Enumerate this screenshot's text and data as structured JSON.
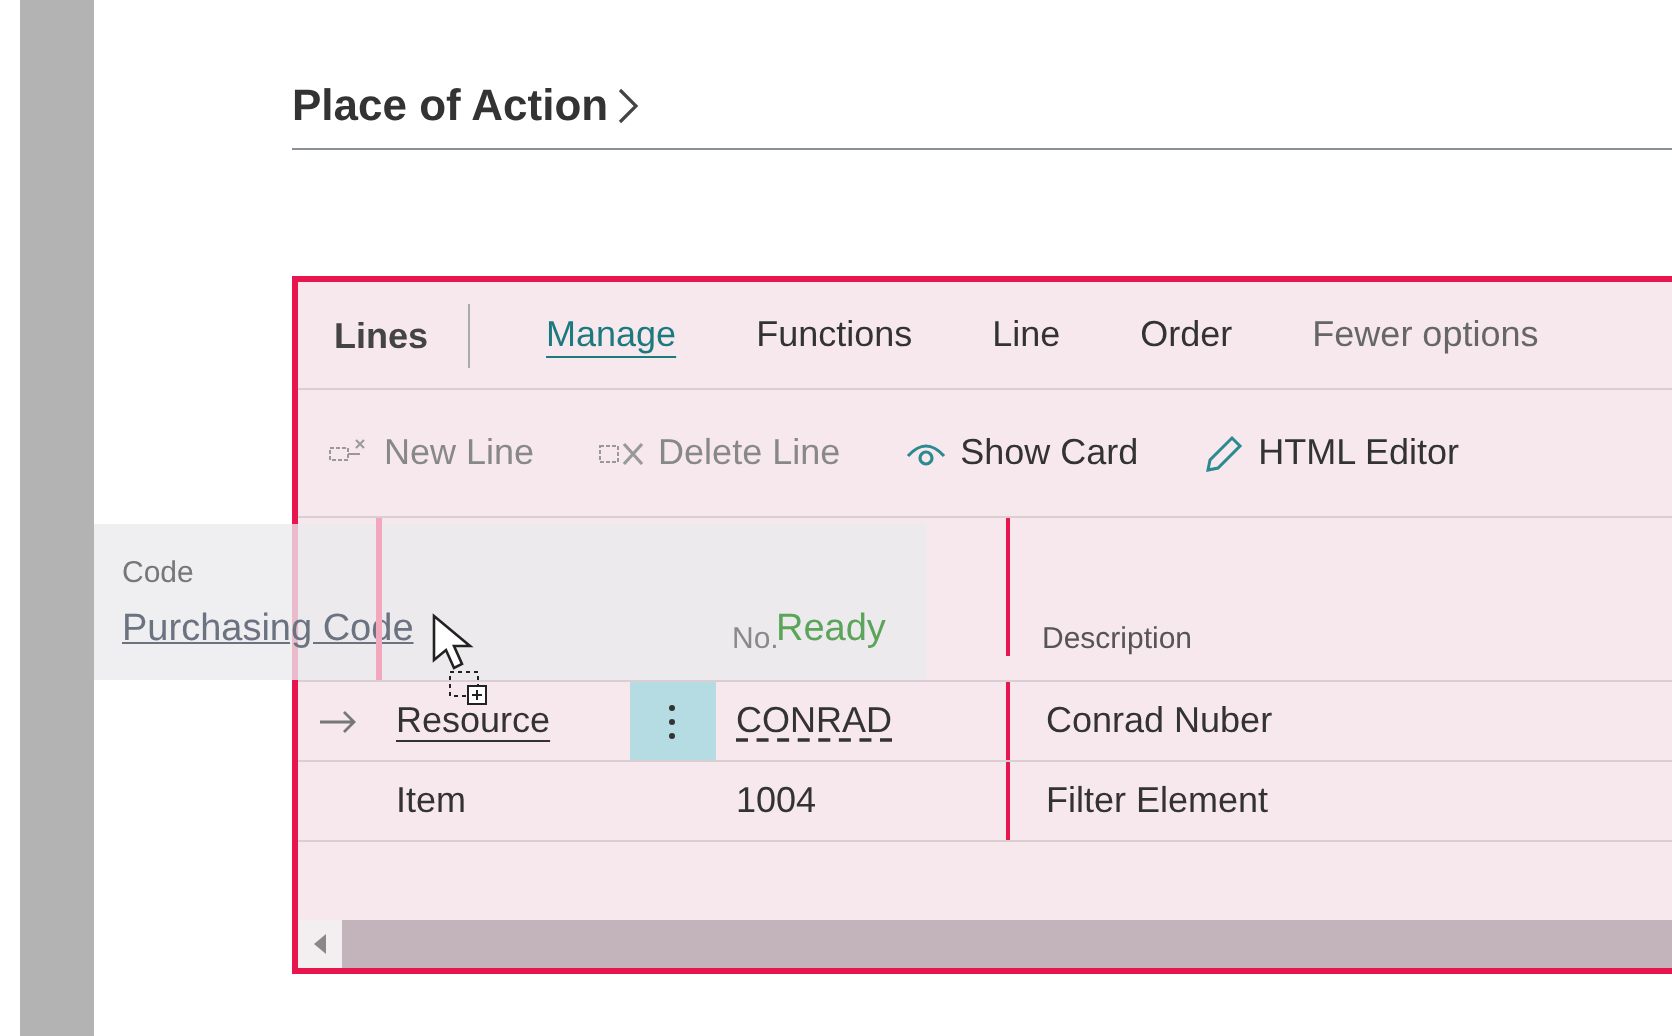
{
  "page_title": "Place of Action",
  "panel": {
    "title": "Lines",
    "tabs": [
      {
        "label": "Manage",
        "selected": true
      },
      {
        "label": "Functions",
        "selected": false
      },
      {
        "label": "Line",
        "selected": false
      },
      {
        "label": "Order",
        "selected": false
      }
    ],
    "fewer_options": "Fewer options",
    "actions": [
      {
        "label": "New Line",
        "disabled": true
      },
      {
        "label": "Delete Line",
        "disabled": true
      },
      {
        "label": "Show Card",
        "disabled": false
      },
      {
        "label": "HTML Editor",
        "disabled": false
      }
    ],
    "columns": [
      "No.",
      "Description"
    ],
    "rows": [
      {
        "current": true,
        "type": "Resource",
        "no": "CONRAD",
        "description": "Conrad Nuber"
      },
      {
        "current": false,
        "type": "Item",
        "no": "1004",
        "description": "Filter Element"
      }
    ]
  },
  "drag_ghost": {
    "label": "Code",
    "value": "Purchasing Code",
    "status": "Ready"
  }
}
